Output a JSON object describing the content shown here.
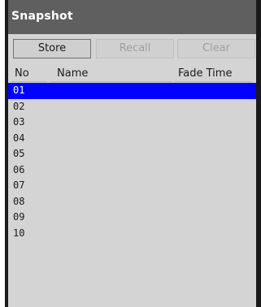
{
  "panel": {
    "title": "Snapshot"
  },
  "toolbar": {
    "store_label": "Store",
    "recall_label": "Recall",
    "clear_label": "Clear"
  },
  "columns": {
    "no": "No",
    "name": "Name",
    "fade_time": "Fade Time"
  },
  "rows": [
    {
      "no": "01",
      "name": "",
      "fade_time": ""
    },
    {
      "no": "02",
      "name": "",
      "fade_time": ""
    },
    {
      "no": "03",
      "name": "",
      "fade_time": ""
    },
    {
      "no": "04",
      "name": "",
      "fade_time": ""
    },
    {
      "no": "05",
      "name": "",
      "fade_time": ""
    },
    {
      "no": "06",
      "name": "",
      "fade_time": ""
    },
    {
      "no": "07",
      "name": "",
      "fade_time": ""
    },
    {
      "no": "08",
      "name": "",
      "fade_time": ""
    },
    {
      "no": "09",
      "name": "",
      "fade_time": ""
    },
    {
      "no": "10",
      "name": "",
      "fade_time": ""
    }
  ],
  "selected_row": "01",
  "colors": {
    "selection": "#0000ff",
    "titlebar": "#5f5f5f",
    "panel": "#d4d4d4"
  }
}
